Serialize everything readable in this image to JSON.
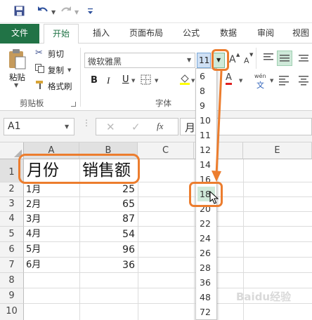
{
  "qat": {
    "save_icon": "save-icon",
    "undo_icon": "undo-icon",
    "redo_icon": "redo-icon",
    "customize_icon": "customize-qat-icon"
  },
  "tabs": [
    {
      "label": "文件"
    },
    {
      "label": "开始"
    },
    {
      "label": "插入"
    },
    {
      "label": "页面布局"
    },
    {
      "label": "公式"
    },
    {
      "label": "数据"
    },
    {
      "label": "审阅"
    },
    {
      "label": "视图"
    }
  ],
  "clipboard": {
    "paste": "粘贴",
    "cut": "剪切",
    "copy": "复制",
    "format_painter": "格式刷",
    "group": "剪贴板"
  },
  "font": {
    "name": "微软雅黑",
    "size": "11",
    "grow": "A",
    "shrink": "A",
    "bold": "B",
    "italic": "I",
    "underline": "U",
    "group": "字体",
    "wen": "wén",
    "wen_glyph": "文"
  },
  "formula": {
    "namebox": "A1",
    "fx": "fx",
    "value": "月"
  },
  "columns": [
    "A",
    "B",
    "C",
    "E"
  ],
  "rows": [
    "1",
    "2",
    "3",
    "4",
    "5",
    "6",
    "7",
    "8",
    "9",
    "10"
  ],
  "cells": {
    "a1": "月份",
    "b1": "销售额",
    "months": [
      "1月",
      "2月",
      "3月",
      "4月",
      "5月",
      "6月"
    ],
    "sales": [
      "25",
      "65",
      "87",
      "54",
      "96",
      "36"
    ]
  },
  "font_sizes": [
    "6",
    "8",
    "9",
    "10",
    "11",
    "12",
    "14",
    "16",
    "18",
    "20",
    "22",
    "24",
    "26",
    "28",
    "36",
    "48",
    "72"
  ],
  "highlight_color": "#ec7d2e",
  "selected_size_bg": "#cfe9d9",
  "accent": "#217346",
  "watermark": "Baidu经验"
}
